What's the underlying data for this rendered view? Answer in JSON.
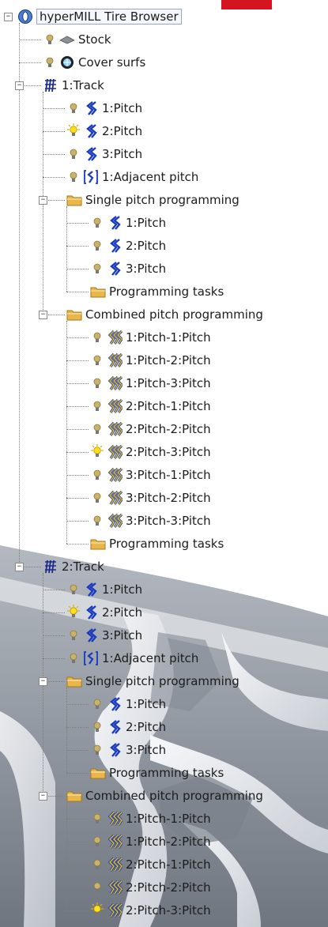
{
  "tree": {
    "nodes": [
      {
        "label": "hyperMILL Tire Browser",
        "icon": "tire-browser-icon",
        "level": 0,
        "expander": "minus"
      },
      {
        "label": "Stock",
        "icon": "stock-icon",
        "level": 1,
        "bulb": "off"
      },
      {
        "label": "Cover surfs",
        "icon": "cover-surfs-icon",
        "level": 1,
        "bulb": "off"
      },
      {
        "label": "1:Track",
        "icon": "track-icon",
        "level": 1,
        "expander": "minus"
      },
      {
        "label": "1:Pitch",
        "icon": "pitch-icon",
        "level": 2,
        "bulb": "off"
      },
      {
        "label": "2:Pitch",
        "icon": "pitch-icon",
        "level": 2,
        "bulb": "on"
      },
      {
        "label": "3:Pitch",
        "icon": "pitch-icon",
        "level": 2,
        "bulb": "off"
      },
      {
        "label": "1:Adjacent pitch",
        "icon": "adjacent-pitch-icon",
        "level": 2,
        "bulb": "off"
      },
      {
        "label": "Single pitch programming",
        "icon": "folder-icon",
        "level": 2,
        "expander": "minus"
      },
      {
        "label": "1:Pitch",
        "icon": "pitch-icon",
        "level": 3,
        "bulb": "off"
      },
      {
        "label": "2:Pitch",
        "icon": "pitch-icon",
        "level": 3,
        "bulb": "off"
      },
      {
        "label": "3:Pitch",
        "icon": "pitch-icon",
        "level": 3,
        "bulb": "off"
      },
      {
        "label": "Programming tasks",
        "icon": "folder-icon",
        "level": 3
      },
      {
        "label": "Combined pitch programming",
        "icon": "folder-icon",
        "level": 2,
        "expander": "minus"
      },
      {
        "label": "1:Pitch-1:Pitch",
        "icon": "combined-pitch-icon",
        "level": 3,
        "bulb": "off"
      },
      {
        "label": "1:Pitch-2:Pitch",
        "icon": "combined-pitch-icon",
        "level": 3,
        "bulb": "off"
      },
      {
        "label": "1:Pitch-3:Pitch",
        "icon": "combined-pitch-icon",
        "level": 3,
        "bulb": "off"
      },
      {
        "label": "2:Pitch-1:Pitch",
        "icon": "combined-pitch-icon",
        "level": 3,
        "bulb": "off"
      },
      {
        "label": "2:Pitch-2:Pitch",
        "icon": "combined-pitch-icon",
        "level": 3,
        "bulb": "off"
      },
      {
        "label": "2:Pitch-3:Pitch",
        "icon": "combined-pitch-icon",
        "level": 3,
        "bulb": "on"
      },
      {
        "label": "3:Pitch-1:Pitch",
        "icon": "combined-pitch-icon",
        "level": 3,
        "bulb": "off"
      },
      {
        "label": "3:Pitch-2:Pitch",
        "icon": "combined-pitch-icon",
        "level": 3,
        "bulb": "off"
      },
      {
        "label": "3:Pitch-3:Pitch",
        "icon": "combined-pitch-icon",
        "level": 3,
        "bulb": "off"
      },
      {
        "label": "Programming tasks",
        "icon": "folder-icon",
        "level": 3
      },
      {
        "label": "2:Track",
        "icon": "track-icon",
        "level": 1,
        "expander": "minus"
      },
      {
        "label": "1:Pitch",
        "icon": "pitch-icon",
        "level": 2,
        "bulb": "off"
      },
      {
        "label": "2:Pitch",
        "icon": "pitch-icon",
        "level": 2,
        "bulb": "on"
      },
      {
        "label": "3:Pitch",
        "icon": "pitch-icon",
        "level": 2,
        "bulb": "off"
      },
      {
        "label": "1:Adjacent pitch",
        "icon": "adjacent-pitch-icon",
        "level": 2,
        "bulb": "off"
      },
      {
        "label": "Single pitch programming",
        "icon": "folder-icon",
        "level": 2,
        "expander": "minus"
      },
      {
        "label": "1:Pitch",
        "icon": "pitch-icon",
        "level": 3,
        "bulb": "off"
      },
      {
        "label": "2:Pitch",
        "icon": "pitch-icon",
        "level": 3,
        "bulb": "off"
      },
      {
        "label": "3:Pitch",
        "icon": "pitch-icon",
        "level": 3,
        "bulb": "off"
      },
      {
        "label": "Programming tasks",
        "icon": "folder-icon",
        "level": 3
      },
      {
        "label": "Combined pitch programming",
        "icon": "folder-icon",
        "level": 2,
        "expander": "minus"
      },
      {
        "label": "1:Pitch-1:Pitch",
        "icon": "combined-pitch-icon",
        "level": 3,
        "bulb": "off"
      },
      {
        "label": "1:Pitch-2:Pitch",
        "icon": "combined-pitch-icon",
        "level": 3,
        "bulb": "off"
      },
      {
        "label": "2:Pitch-1:Pitch",
        "icon": "combined-pitch-icon",
        "level": 3,
        "bulb": "off"
      },
      {
        "label": "2:Pitch-2:Pitch",
        "icon": "combined-pitch-icon",
        "level": 3,
        "bulb": "off"
      },
      {
        "label": "2:Pitch-3:Pitch",
        "icon": "combined-pitch-icon",
        "level": 3,
        "bulb": "on"
      }
    ]
  },
  "colors": {
    "pitch_icon": "#1a3bbf",
    "combined_outline": "#1a3bbf",
    "combined_fill": "#f2c200",
    "folder": "#e8b64a",
    "bulb_off": "#c9b36a",
    "bulb_on": "#ffe01a",
    "accent_red": "#d4151f",
    "tire_background": "#9aa0a9"
  }
}
